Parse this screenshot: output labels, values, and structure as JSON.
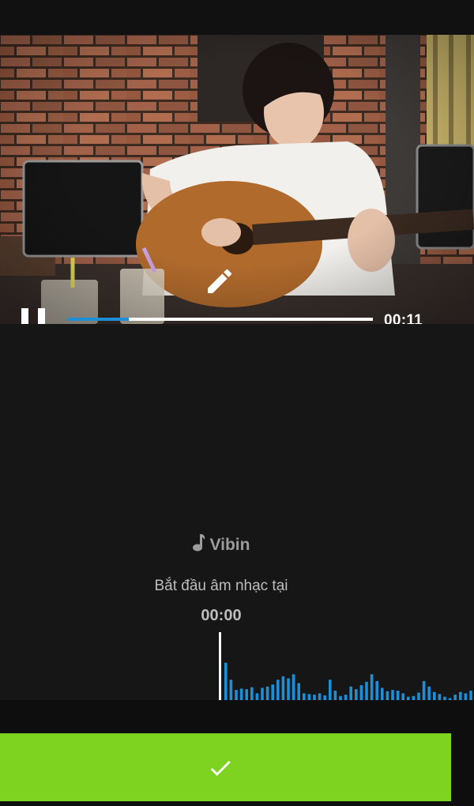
{
  "player": {
    "time": "00:11",
    "progress": 0.2
  },
  "music": {
    "icon": "music-note-icon",
    "title": "Vibin",
    "start_label": "Bắt đầu âm nhạc tại",
    "start_time": "00:00",
    "waveform_levels": [
      0.55,
      0.3,
      0.15,
      0.17,
      0.16,
      0.19,
      0.1,
      0.18,
      0.2,
      0.23,
      0.3,
      0.35,
      0.32,
      0.38,
      0.25,
      0.1,
      0.09,
      0.08,
      0.1,
      0.07,
      0.3,
      0.14,
      0.06,
      0.08,
      0.2,
      0.16,
      0.22,
      0.27,
      0.38,
      0.28,
      0.18,
      0.13,
      0.15,
      0.14,
      0.1,
      0.05,
      0.06,
      0.11,
      0.28,
      0.2,
      0.12,
      0.09,
      0.05,
      0.03,
      0.08,
      0.12,
      0.1,
      0.14,
      0.1,
      0.18
    ]
  },
  "actions": {
    "confirm_icon": "checkmark-icon",
    "edit_icon": "pencil-icon",
    "pause_icon": "pause-icon"
  },
  "colors": {
    "accent": "#1c8fd6",
    "confirm": "#7ed321",
    "background": "#161617"
  }
}
